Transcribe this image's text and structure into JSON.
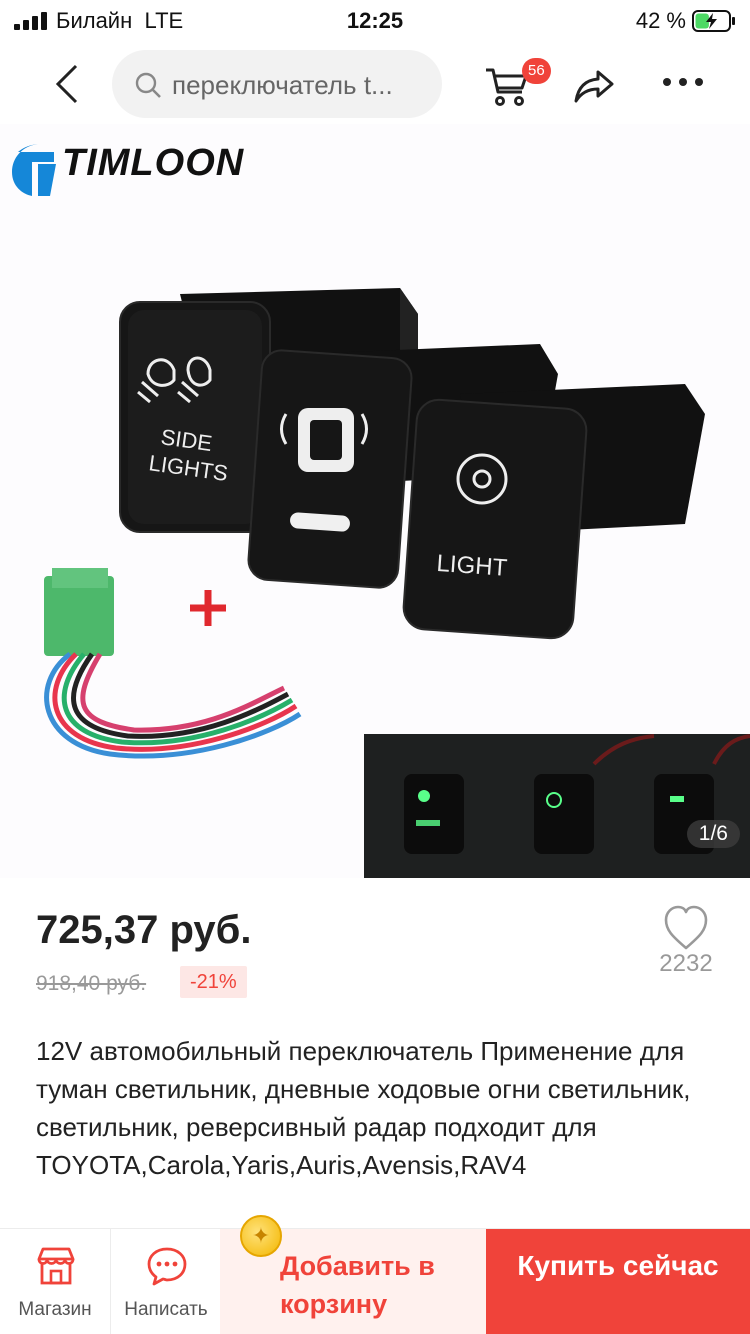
{
  "status_bar": {
    "carrier": "Билайн",
    "network": "LTE",
    "time": "12:25",
    "battery": "42 %",
    "battery_level": 0.42
  },
  "nav": {
    "search_text": "переключатель t...",
    "cart_count": "56",
    "back_icon": "chevron-left-icon",
    "cart_icon": "cart-icon",
    "share_icon": "share-arrow-icon",
    "more_icon": "more-dots-icon"
  },
  "gallery": {
    "brand": "TIMLOON",
    "switch_labels": [
      "SIDE\nLIGHTS",
      "LIGHT"
    ],
    "counter": "1/6"
  },
  "product": {
    "price": "725,37 руб.",
    "old_price": "918,40 руб.",
    "discount": "-21%",
    "wishlist_count": "2232",
    "title": "12V автомобильный переключатель Применение для туман светильник, дневные ходовые огни светильник, светильник, реверсивный радар подходит для TOYOTA,Carola,Yaris,Auris,Avensis,RAV4"
  },
  "bottom_bar": {
    "store_label": "Магазин",
    "chat_label": "Написать",
    "add_to_cart_label": "Добавить в корзину",
    "buy_now_label": "Купить сейчас"
  },
  "colors": {
    "accent": "#f0433a",
    "accent_light": "#fff1ee",
    "text": "#222222",
    "muted": "#999999"
  }
}
